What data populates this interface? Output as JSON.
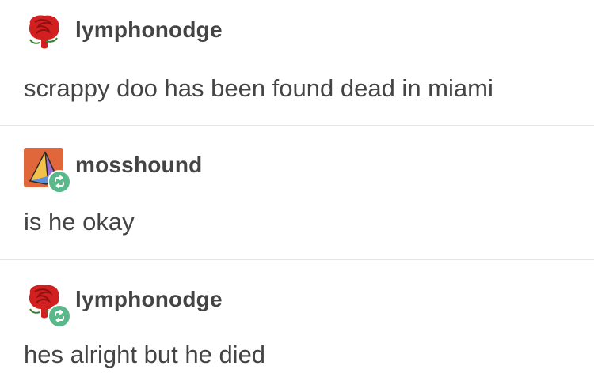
{
  "posts": [
    {
      "username": "lymphonodge",
      "avatar_icon": "rose-avatar-icon",
      "reblogged": false,
      "body": "scrappy doo has been found dead in miami"
    },
    {
      "username": "mosshound",
      "avatar_icon": "pyramid-avatar-icon",
      "reblogged": true,
      "body": "is he okay"
    },
    {
      "username": "lymphonodge",
      "avatar_icon": "rose-avatar-icon",
      "reblogged": true,
      "body": "hes alright but he died"
    }
  ],
  "colors": {
    "text": "#444444",
    "reblog_badge": "#5ab98b",
    "divider": "#e6e6e6",
    "rose_red": "#d21f1f",
    "pyramid_bg": "#e0673a"
  }
}
